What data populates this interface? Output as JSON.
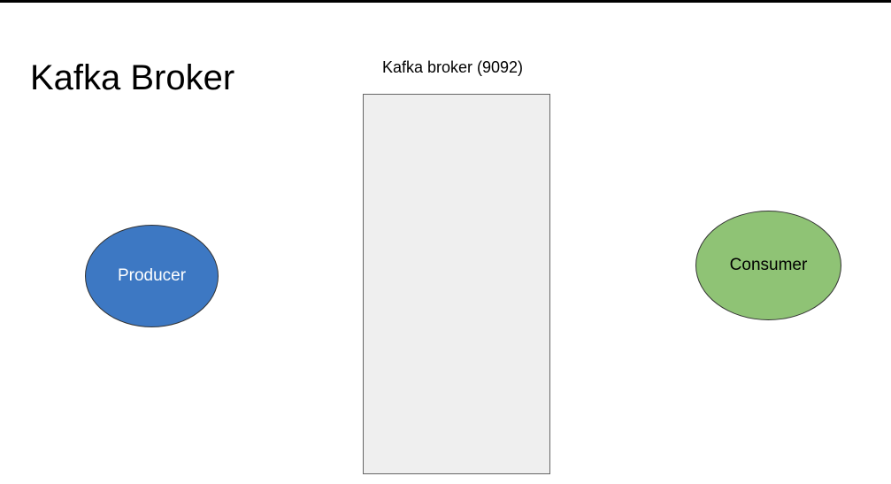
{
  "slide": {
    "title": "Kafka Broker"
  },
  "broker": {
    "label": "Kafka broker (9092)",
    "fill_color": "#efefef",
    "border_color": "#666666"
  },
  "nodes": {
    "producer": {
      "label": "Producer",
      "fill_color": "#3d78c3",
      "text_color": "#ffffff"
    },
    "consumer": {
      "label": "Consumer",
      "fill_color": "#8fc375",
      "text_color": "#000000"
    }
  }
}
